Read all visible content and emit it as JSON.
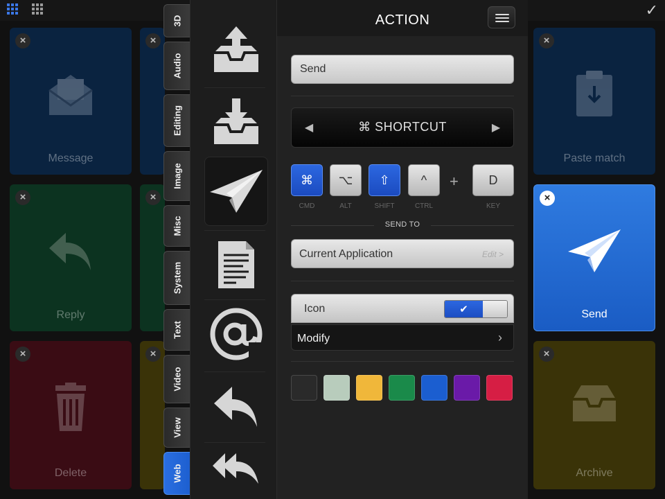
{
  "tiles": {
    "message_label": "Message",
    "reply_label": "Reply",
    "delete_label": "Delete",
    "paste_match_label": "Paste match",
    "send_label": "Send",
    "archive_label": "Archive",
    "close_glyph": "×"
  },
  "categories": [
    "3D",
    "Audio",
    "Editing",
    "Image",
    "Misc",
    "System",
    "Text",
    "Video",
    "View",
    "Web"
  ],
  "active_category": "Web",
  "strip_icons": [
    "outbox-icon",
    "inbox-icon",
    "paper-plane-icon",
    "document-icon",
    "at-sign-icon",
    "reply-icon",
    "reply-all-icon"
  ],
  "panel": {
    "title": "ACTION",
    "name_value": "Send",
    "shortcut_label": "⌘ SHORTCUT",
    "shortcut_prev": "◀",
    "shortcut_next": "▶",
    "keys": [
      {
        "glyph": "⌘",
        "caption": "CMD",
        "on": true
      },
      {
        "glyph": "⌥",
        "caption": "ALT",
        "on": false
      },
      {
        "glyph": "⇧",
        "caption": "SHIFT",
        "on": true
      },
      {
        "glyph": "^",
        "caption": "CTRL",
        "on": false
      }
    ],
    "plus": "+",
    "key_value": "D",
    "key_caption": "KEY",
    "send_to_label": "SEND TO",
    "send_to_value": "Current Application",
    "edit_label": "Edit >",
    "icon_label": "Icon",
    "icon_toggle_check": "✔",
    "icon_enabled": true,
    "modify_label": "Modify",
    "modify_chevron": "›"
  },
  "colors": {
    "swatches": [
      "#2a2a2a",
      "#b8ccbc",
      "#f0b73a",
      "#1a8a4a",
      "#1b5ed0",
      "#6a1aa8",
      "#d61e44"
    ],
    "accent": "#2c67e0"
  },
  "check_glyph": "✓"
}
